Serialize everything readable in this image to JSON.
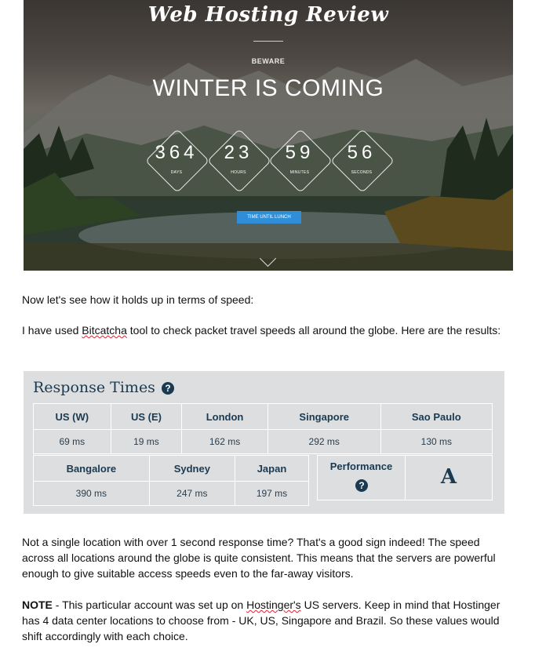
{
  "hero": {
    "logo": "Web Hosting Review",
    "eyebrow": "BEWARE",
    "headline": "WINTER IS COMING",
    "countdown": [
      {
        "value": "364",
        "label": "DAYS"
      },
      {
        "value": "23",
        "label": "HOURS"
      },
      {
        "value": "59",
        "label": "MINUTES"
      },
      {
        "value": "56",
        "label": "SECONDS"
      }
    ],
    "button_label": "TIME UNTIL LUNCH"
  },
  "intro": "Now let's see how it holds up in terms of speed:",
  "tool_sentence": {
    "before": "I have used ",
    "link": "Bitcatcha",
    "after": " tool to check packet travel speeds all around the globe. Here are the results:"
  },
  "response": {
    "title": "Response Times",
    "row1": [
      {
        "location": "US (W)",
        "time": "69 ms"
      },
      {
        "location": "US (E)",
        "time": "19 ms"
      },
      {
        "location": "London",
        "time": "162 ms"
      },
      {
        "location": "Singapore",
        "time": "292 ms"
      },
      {
        "location": "Sao Paulo",
        "time": "130 ms"
      }
    ],
    "row2": [
      {
        "location": "Bangalore",
        "time": "390 ms"
      },
      {
        "location": "Sydney",
        "time": "247 ms"
      },
      {
        "location": "Japan",
        "time": "197 ms"
      }
    ],
    "performance_label": "Performance",
    "grade": "A"
  },
  "conclusion": "Not a single location with over 1 second response time? That's a good sign indeed! The speed across all locations around the globe is quite consistent. This means that the servers are powerful enough to give suitable access speeds even to the far-away visitors.",
  "note": {
    "label": "NOTE",
    "before": " - This particular account was set up on ",
    "link": "Hostinger's",
    "after": " US servers. Keep in mind that Hostinger has 4 data center locations to choose from - UK, US, Singapore and Brazil. So these values would shift accordingly with each choice."
  }
}
